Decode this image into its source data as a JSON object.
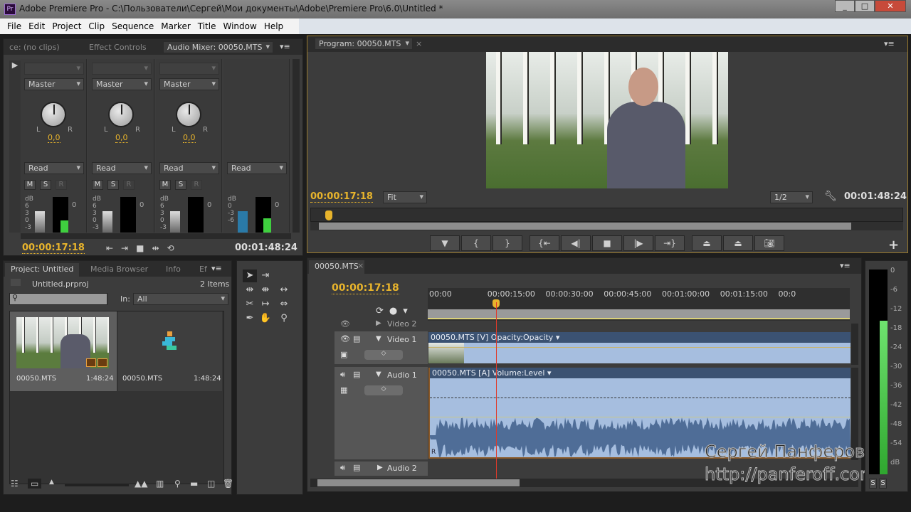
{
  "window": {
    "title": "Adobe Premiere Pro - C:\\Пользователи\\Сергей\\Мои документы\\Adobe\\Premiere Pro\\6.0\\Untitled *",
    "logo": "Pr",
    "controls": [
      "minimize",
      "maximize",
      "close"
    ]
  },
  "menu": [
    "File",
    "Edit",
    "Project",
    "Clip",
    "Sequence",
    "Marker",
    "Title",
    "Window",
    "Help"
  ],
  "source_panel": {
    "tabs": [
      "ce: (no clips)",
      "Effect Controls",
      "Audio Mixer: 00050.MTS"
    ]
  },
  "mixer": {
    "channels": [
      {
        "output": "Master",
        "pan": "0,0",
        "mode": "Read",
        "buttons": [
          "M",
          "S",
          "R"
        ],
        "db_ticks": [
          "dB",
          "6",
          "3",
          "0",
          "-3"
        ],
        "level": 0.35
      },
      {
        "output": "Master",
        "pan": "0,0",
        "mode": "Read",
        "buttons": [
          "M",
          "S",
          "R"
        ],
        "db_ticks": [
          "dB",
          "6",
          "3",
          "0",
          "-3"
        ],
        "level": 0
      },
      {
        "output": "Master",
        "pan": "0,0",
        "mode": "Read",
        "buttons": [
          "M",
          "S",
          "R"
        ],
        "db_ticks": [
          "dB",
          "6",
          "3",
          "0",
          "-3"
        ],
        "level": 0
      },
      {
        "mode": "Read",
        "db_ticks": [
          "dB",
          "0",
          "-3",
          "-6"
        ],
        "level": 0.4
      }
    ],
    "meter_zero": "0",
    "pan_l": "L",
    "pan_r": "R",
    "current_time": "00:00:17:18",
    "duration": "00:01:48:24"
  },
  "program": {
    "tab": "Program: 00050.MTS",
    "current_time": "00:00:17:18",
    "zoom": "Fit",
    "resolution": "1/2",
    "duration": "00:01:48:24",
    "buttons": [
      "add-marker",
      "mark-in",
      "mark-out",
      "go-to-in",
      "step-back",
      "stop",
      "play",
      "go-to-out",
      "lift",
      "extract",
      "export-frame"
    ]
  },
  "project": {
    "tabs": [
      "Project: Untitled",
      "Media Browser",
      "Info",
      "Ef"
    ],
    "file": "Untitled.prproj",
    "count": "2 Items",
    "in_label": "In:",
    "in_value": "All",
    "search_placeholder": "",
    "items": [
      {
        "name": "00050.MTS",
        "duration": "1:48:24",
        "type": "clip"
      },
      {
        "name": "00050.MTS",
        "duration": "1:48:24",
        "type": "sequence"
      }
    ]
  },
  "tools": [
    "selection",
    "track-select",
    "ripple-edit",
    "rolling-edit",
    "rate-stretch",
    "razor",
    "slip",
    "slide",
    "pen",
    "hand",
    "zoom"
  ],
  "timeline": {
    "tab": "00050.MTS",
    "current_time": "00:00:17:18",
    "playhead_seconds": 17.7,
    "total_seconds": 108.8,
    "ruler": [
      "00:00",
      "00:00:15:00",
      "00:00:30:00",
      "00:00:45:00",
      "00:01:00:00",
      "00:01:15:00",
      "00:0"
    ],
    "tracks": {
      "video2": "Video 2",
      "video1": "Video 1",
      "audio1": "Audio 1",
      "audio2": "Audio 2"
    },
    "video_clip": {
      "name": "00050.MTS [V]",
      "effect": "Opacity:Opacity"
    },
    "audio_clip": {
      "name": "00050.MTS [A]",
      "effect": "Volume:Level",
      "channel": "R"
    }
  },
  "master_meter": {
    "ticks": [
      "0",
      "-6",
      "-12",
      "-18",
      "-24",
      "-30",
      "-36",
      "-42",
      "-48",
      "-54",
      "dB"
    ],
    "level_db": -15,
    "solo": [
      "S",
      "S"
    ]
  },
  "watermark": {
    "name": "Сергей Панферов",
    "url": "http://panferoff.com"
  },
  "colors": {
    "timecode": "#e8b42c",
    "clip": "#a6bedf",
    "clip_header": "#3b5272",
    "meter": "#3fcf3f",
    "playhead": "#e03a2a"
  }
}
